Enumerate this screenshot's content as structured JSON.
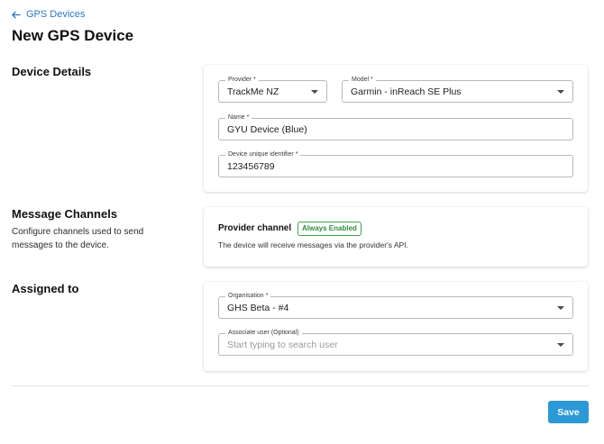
{
  "nav": {
    "back_label": "GPS Devices"
  },
  "page": {
    "title": "New GPS Device"
  },
  "sections": {
    "device_details": {
      "title": "Device Details",
      "provider": {
        "label": "Provider *",
        "value": "TrackMe NZ"
      },
      "model": {
        "label": "Model *",
        "value": "Garmin - inReach SE Plus"
      },
      "name": {
        "label": "Name *",
        "value": "GYU Device (Blue)"
      },
      "identifier": {
        "label": "Device unique identifier *",
        "value": "123456789"
      }
    },
    "message_channels": {
      "title": "Message Channels",
      "description": "Configure channels used to send messages to the device.",
      "channel_title": "Provider channel",
      "badge": "Always Enabled",
      "channel_description": "The device will receive messages via the provider's API."
    },
    "assigned_to": {
      "title": "Assigned to",
      "organisation": {
        "label": "Organisation *",
        "value": "GHS Beta - #4"
      },
      "user": {
        "label": "Associate user (Optional)",
        "placeholder": "Start typing to search user"
      }
    }
  },
  "actions": {
    "save_label": "Save"
  },
  "colors": {
    "accent": "#2a99d6",
    "link": "#2a79c2",
    "badge": "#2f8f42"
  },
  "icons": {
    "back": "arrow-left-icon",
    "dropdown": "caret-down-icon"
  }
}
